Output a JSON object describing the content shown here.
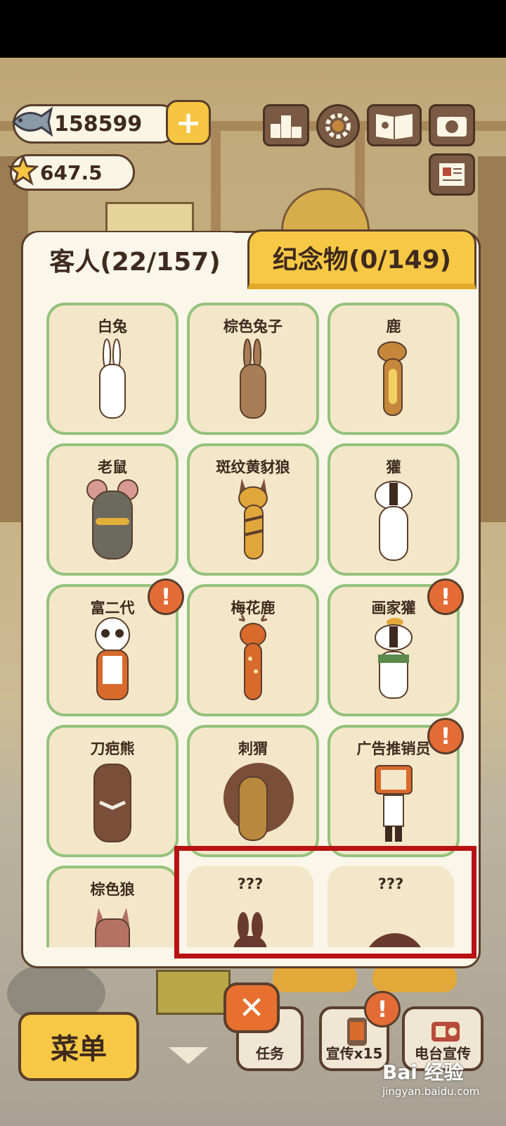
{
  "currency": {
    "fish": "158599",
    "stars": "647.5"
  },
  "tabs": {
    "guests": "客人(22/157)",
    "souvenirs": "纪念物(0/149)"
  },
  "guests": [
    {
      "name": "白兔",
      "color": "#ffffff",
      "alert": false
    },
    {
      "name": "棕色兔子",
      "color": "#a97d55",
      "alert": false
    },
    {
      "name": "鹿",
      "color": "#c6873d",
      "alert": false
    },
    {
      "name": "老鼠",
      "color": "#6c6a5f",
      "alert": false
    },
    {
      "name": "斑纹黄豺狼",
      "color": "#e0a63a",
      "alert": false
    },
    {
      "name": "獾",
      "color": "#ffffff",
      "alert": false
    },
    {
      "name": "富二代",
      "color": "#ffffff",
      "alert": true
    },
    {
      "name": "梅花鹿",
      "color": "#d86a2c",
      "alert": false
    },
    {
      "name": "画家獾",
      "color": "#ffffff",
      "alert": true
    },
    {
      "name": "刀疤熊",
      "color": "#7b4e3a",
      "alert": false
    },
    {
      "name": "刺猬",
      "color": "#b9883f",
      "alert": false
    },
    {
      "name": "广告推销员",
      "color": "#d86a2c",
      "alert": true
    },
    {
      "name": "棕色狼",
      "color": "#b47265",
      "alert": false
    },
    {
      "name": "???",
      "color": "#6b3a2e",
      "alert": false
    },
    {
      "name": "???",
      "color": "#6b3a2e",
      "alert": false
    }
  ],
  "bottom": {
    "menu": "菜单",
    "tasks": "任务",
    "promo": "宣传x15",
    "radio": "电台宣传"
  },
  "watermark": {
    "brand": "Bai 经验",
    "url": "jingyan.baidu.com"
  },
  "colors": {
    "accent": "#f7c845",
    "card_border": "#95c27c",
    "highlight": "#b81212",
    "alert": "#e36b35"
  }
}
